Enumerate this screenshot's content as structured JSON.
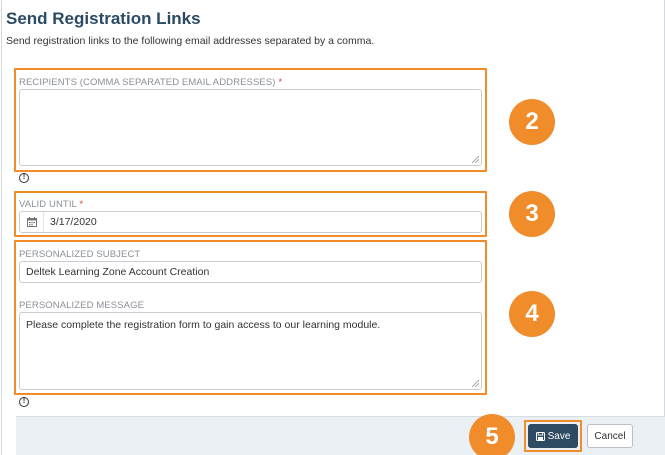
{
  "header": {
    "title": "Send Registration Links",
    "subtitle": "Send registration links to the following email addresses separated by a comma."
  },
  "recipients": {
    "label": "RECIPIENTS (COMMA SEPARATED EMAIL ADDRESSES)",
    "required_mark": "*",
    "value": ""
  },
  "valid_until": {
    "label": "VALID UNTIL",
    "required_mark": "*",
    "value": "3/17/2020",
    "icon": "calendar-icon"
  },
  "subject": {
    "label": "PERSONALIZED SUBJECT",
    "value": "Deltek Learning Zone Account Creation"
  },
  "message": {
    "label": "PERSONALIZED MESSAGE",
    "value": "Please complete the registration form to gain access to our learning module."
  },
  "callouts": {
    "two": "2",
    "three": "3",
    "four": "4",
    "five": "5"
  },
  "footer": {
    "save_label": "Save",
    "cancel_label": "Cancel"
  },
  "colors": {
    "accent": "#f08c2a",
    "title": "#2b4a64",
    "save_bg": "#2f4a63",
    "footer_bg": "#ebf0f5",
    "required": "#e03a3a"
  }
}
